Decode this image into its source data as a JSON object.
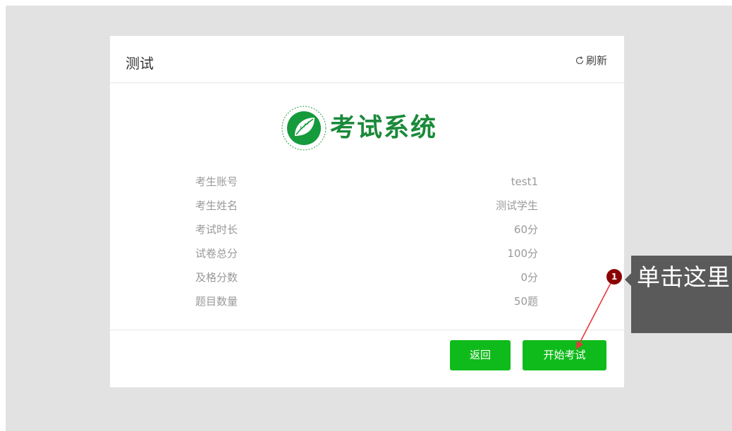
{
  "card": {
    "title": "测试",
    "refresh_label": "刷新"
  },
  "logo": {
    "text": "考试系统"
  },
  "info": [
    {
      "label": "考生账号",
      "value": "test1"
    },
    {
      "label": "考生姓名",
      "value": "测试学生"
    },
    {
      "label": "考试时长",
      "value": "60分"
    },
    {
      "label": "试卷总分",
      "value": "100分"
    },
    {
      "label": "及格分数",
      "value": "0分"
    },
    {
      "label": "题目数量",
      "value": "50题"
    }
  ],
  "buttons": {
    "back_label": "返回",
    "start_label": "开始考试"
  },
  "callout": {
    "step_number": "1",
    "text": "单击这里"
  },
  "colors": {
    "accent_green": "#0fbb1a",
    "logo_green": "#1a8a3a",
    "callout_dot": "#8b0000",
    "callout_box": "#5a5a5a",
    "arrow_red": "#e8383d"
  },
  "icons": {
    "refresh": "refresh-icon",
    "logo": "leaf-emblem-icon"
  }
}
